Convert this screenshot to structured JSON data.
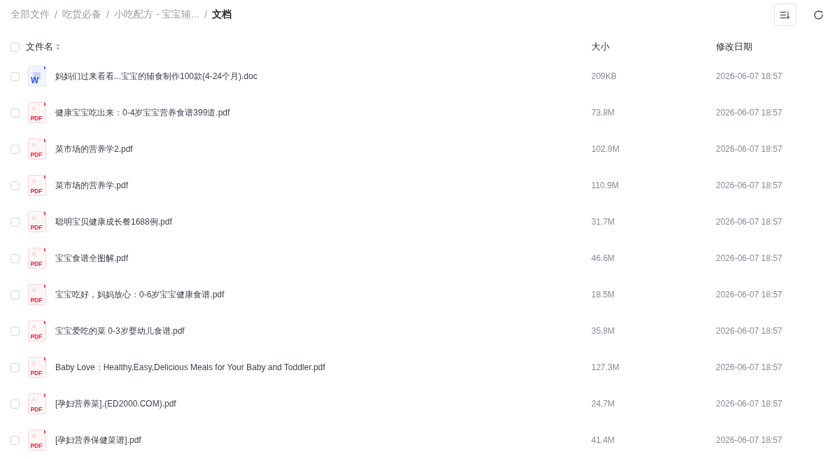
{
  "breadcrumb": [
    {
      "kind": "link",
      "label": "全部文件"
    },
    {
      "kind": "separator",
      "label": "/"
    },
    {
      "kind": "link",
      "label": "吃货必备"
    },
    {
      "kind": "separator",
      "label": "/"
    },
    {
      "kind": "link",
      "label": "小吃配方 - 宝宝辅..."
    },
    {
      "kind": "separator",
      "label": "/"
    },
    {
      "kind": "current",
      "label": "文档"
    }
  ],
  "table": {
    "select_all_checked": false,
    "columns": [
      {
        "label": "文件名",
        "sortable": true
      },
      {
        "label": "大小",
        "sortable": false
      },
      {
        "label": "修改日期",
        "sortable": false
      }
    ],
    "rows": [
      {
        "checked": false,
        "kind": "doc",
        "icon_text": "W",
        "name": "妈妈们过来看看...宝宝的辅食制作100款(4-24个月).doc",
        "size": "209KB",
        "modified": "2026-06-07 18:57"
      },
      {
        "checked": false,
        "kind": "pdf",
        "icon_text": "PDF",
        "name": "健康宝宝吃出来：0-4岁宝宝营养食谱399道.pdf",
        "size": "73.8M",
        "modified": "2026-06-07 18:57"
      },
      {
        "checked": false,
        "kind": "pdf",
        "icon_text": "PDF",
        "name": "菜市场的营养学2.pdf",
        "size": "102.9M",
        "modified": "2026-06-07 18:57"
      },
      {
        "checked": false,
        "kind": "pdf",
        "icon_text": "PDF",
        "name": "菜市场的营养学.pdf",
        "size": "110.9M",
        "modified": "2026-06-07 18:57"
      },
      {
        "checked": false,
        "kind": "pdf",
        "icon_text": "PDF",
        "name": "聪明宝贝健康成长餐1688例.pdf",
        "size": "31.7M",
        "modified": "2026-06-07 18:57"
      },
      {
        "checked": false,
        "kind": "pdf",
        "icon_text": "PDF",
        "name": "宝宝食谱全图解.pdf",
        "size": "46.6M",
        "modified": "2026-06-07 18:57"
      },
      {
        "checked": false,
        "kind": "pdf",
        "icon_text": "PDF",
        "name": "宝宝吃好，妈妈放心：0-6岁宝宝健康食谱.pdf",
        "size": "18.5M",
        "modified": "2026-06-07 18:57"
      },
      {
        "checked": false,
        "kind": "pdf",
        "icon_text": "PDF",
        "name": "宝宝爱吃的菜 0-3岁婴幼儿食谱.pdf",
        "size": "35.8M",
        "modified": "2026-06-07 18:57"
      },
      {
        "checked": false,
        "kind": "pdf",
        "icon_text": "PDF",
        "name": "Baby Love：Healthy,Easy,Delicious Meals for Your Baby and Toddler.pdf",
        "size": "127.3M",
        "modified": "2026-06-07 18:57"
      },
      {
        "checked": false,
        "kind": "pdf",
        "icon_text": "PDF",
        "name": "[孕妇营养菜].(ED2000.COM).pdf",
        "size": "24.7M",
        "modified": "2026-06-07 18:57"
      },
      {
        "checked": false,
        "kind": "pdf",
        "icon_text": "PDF",
        "name": "[孕妇营养保健菜谱].pdf",
        "size": "41.4M",
        "modified": "2026-06-07 18:57"
      }
    ]
  }
}
